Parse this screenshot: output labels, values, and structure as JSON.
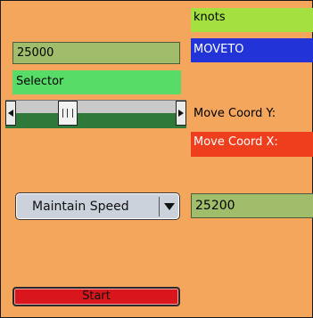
{
  "left_panel": {
    "value_field": "25000",
    "selector_label": "Selector",
    "slider": {
      "level_percent": 30
    },
    "dropdown": {
      "selected": "Maintain Speed"
    },
    "start_button": "Start"
  },
  "right_panel": {
    "units_label": "knots",
    "command_label": "MOVETO",
    "coord_y_label": "Move Coord Y:",
    "coord_x_label": "Move Coord X:",
    "value_field": "25200"
  },
  "colors": {
    "background": "#f3a65c",
    "field": "#9fbd6a",
    "selector": "#57dc68",
    "knots": "#a3e040",
    "moveto": "#2233d8",
    "coord_x": "#ee3e1e",
    "start": "#d8161b"
  },
  "icons": {
    "slider_left": "arrow-left-icon",
    "slider_right": "arrow-right-icon",
    "slider_thumb": "grip-icon",
    "dropdown_caret": "chevron-down-icon"
  }
}
